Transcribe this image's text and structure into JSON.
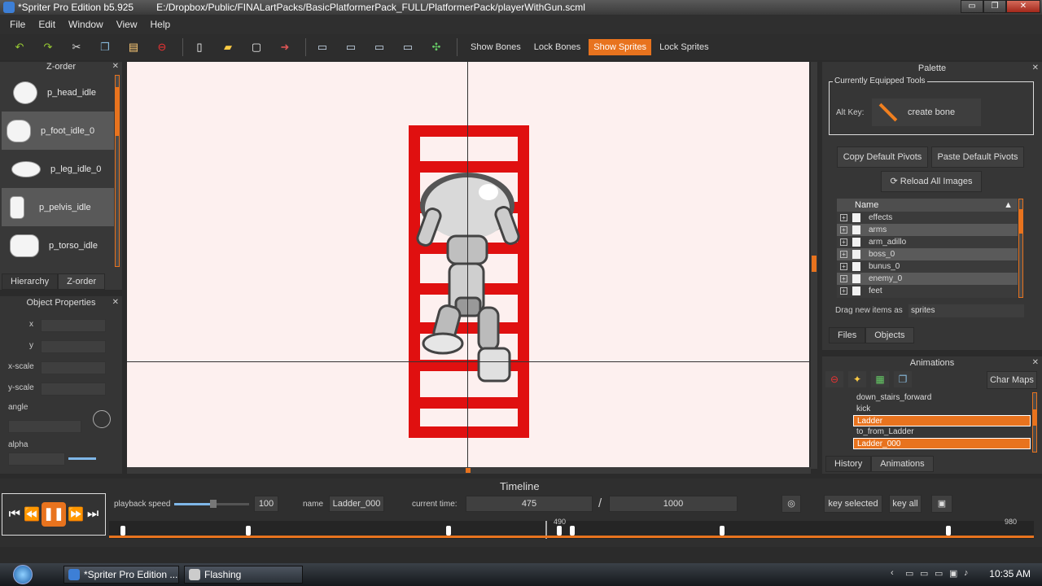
{
  "window": {
    "app_title": "*Spriter Pro Edition b5.925",
    "file_path": "E:/Dropbox/Public/FINALartPacks/BasicPlatformerPack_FULL/PlatformerPack/playerWithGun.scml",
    "btn_min": "▭",
    "btn_max": "❐",
    "btn_close": "✕"
  },
  "menu": [
    "File",
    "Edit",
    "Window",
    "View",
    "Help"
  ],
  "toolbar": {
    "toggles": [
      "Show Bones",
      "Lock Bones",
      "Show Sprites",
      "Lock Sprites"
    ],
    "active_toggle": "Show Sprites",
    "accent": "#e8731e"
  },
  "zorder": {
    "title": "Z-order",
    "close": "✕",
    "items": [
      "p_head_idle",
      "p_foot_idle_0",
      "p_leg_idle_0",
      "p_pelvis_idle",
      "p_torso_idle"
    ],
    "tabs": [
      "Hierarchy",
      "Z-order"
    ]
  },
  "object_properties": {
    "title": "Object Properties",
    "close": "✕",
    "fields": [
      "x",
      "y",
      "x-scale",
      "y-scale",
      "angle",
      "alpha"
    ]
  },
  "palette": {
    "title": "Palette",
    "close": "✕",
    "equipped_title": "Currently Equipped Tools",
    "alt_key_label": "Alt Key:",
    "tool_label": "create bone",
    "copy_pivots": "Copy Default Pivots",
    "paste_pivots": "Paste Default Pivots",
    "reload": "Reload All Images",
    "tree_header": "Name",
    "folders": [
      "effects",
      "arms",
      "arm_adillo",
      "boss_0",
      "bunus_0",
      "enemy_0",
      "feet"
    ],
    "drag_label": "Drag new items as",
    "drag_value": "sprites",
    "tabs": [
      "Files",
      "Objects"
    ]
  },
  "animations": {
    "title": "Animations",
    "close": "✕",
    "char_maps": "Char Maps",
    "list": [
      "down_stairs_forward",
      "kick",
      "Ladder",
      "to_from_Ladder",
      "Ladder_000"
    ],
    "selected": [
      "Ladder",
      "Ladder_000"
    ],
    "tabs": [
      "History",
      "Animations"
    ]
  },
  "timeline": {
    "title": "Timeline",
    "playback_label": "playback speed",
    "playback_value": "100",
    "name_label": "name",
    "name_value": "Ladder_000",
    "current_time_label": "current time:",
    "current_time": "475",
    "separator": "/",
    "total_time": "1000",
    "key_selected": "key selected",
    "key_all": "key all",
    "tick_labels": [
      "490",
      "980"
    ],
    "playback_fraction": 0.48
  },
  "taskbar": {
    "tasks": [
      "*Spriter Pro Edition ...",
      "Flashing"
    ],
    "clock": "10:35 AM"
  }
}
